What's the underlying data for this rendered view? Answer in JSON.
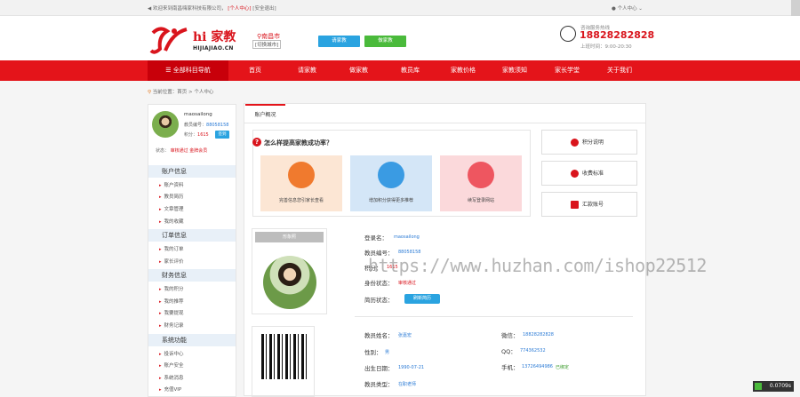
{
  "topbar": {
    "welcome": "欢迎来到南昌嗨家科技有限公司，",
    "personal": "[个人中心]",
    "logout": "[安全退出]",
    "user_menu": "个人中心 ⌄"
  },
  "header": {
    "logo_text": "hi 家教",
    "logo_sub": "HIJIAJIAO.CN",
    "city": "南昌市",
    "city_switch": "[切换城市]",
    "btn_request": "请家教",
    "btn_apply": "做家教",
    "hotline_label": "咨询服务热线",
    "hotline_number": "18828282828",
    "hours": "上班时间：9:00-20:30"
  },
  "nav": {
    "all_subjects": "全部科目导航",
    "items": [
      "首页",
      "请家教",
      "做家教",
      "教员库",
      "家教价格",
      "家教须知",
      "家长学堂",
      "关于我们"
    ]
  },
  "breadcrumb": "当前位置：首页 > 个人中心",
  "sidebar": {
    "username": "maosailong",
    "member_id_label": "教员编号：",
    "member_id": "88058158",
    "points_label": "积分：",
    "points": "1615",
    "sign_button": "签到",
    "status_label": "状态：",
    "status_review": "审核通过",
    "status_level": "金牌会员",
    "groups": [
      {
        "title": "账户信息",
        "links": [
          "账户资料",
          "教员简历",
          "文章管理",
          "我的收藏"
        ]
      },
      {
        "title": "订单信息",
        "links": [
          "我的订单",
          "家长评价"
        ]
      },
      {
        "title": "财务信息",
        "links": [
          "我的积分",
          "我的推荐",
          "我要提现",
          "财务记录"
        ]
      },
      {
        "title": "系统功能",
        "links": [
          "投诉中心",
          "账户安全",
          "系统消息",
          "充值VIP"
        ]
      }
    ]
  },
  "main": {
    "tab": "账户概况",
    "how_title": "怎么样提高家教成功率？",
    "features": [
      "完善信息您引家长查看",
      "增加积分获得更多推荐",
      "续写登录网站"
    ],
    "side_buttons": [
      "积分说明",
      "收费标准",
      "汇款账号"
    ],
    "photo_tag": "形象照",
    "account": {
      "login_label": "登录名：",
      "login_value": "maosailong",
      "id_label": "教员编号：",
      "id_value": "88058158",
      "points_label": "积分：",
      "points_value": "1615",
      "identity_label": "身份状态：",
      "identity_value": "审核通过",
      "resume_label": "简历状态：",
      "resume_button": "刷新简历"
    },
    "profile": {
      "name_label": "教员姓名：",
      "name_value": "张嘉宏",
      "gender_label": "性别：",
      "gender_value": "男",
      "birth_label": "出生日期：",
      "birth_value": "1990-07-21",
      "type_label": "教员类型：",
      "type_value": "在职老师",
      "wechat_label": "微信：",
      "wechat_value": "18828282828",
      "qq_label": "QQ：",
      "qq_value": "774362532",
      "mobile_label": "手机：",
      "mobile_value": "13726494986",
      "mobile_verified": "已绑定"
    }
  },
  "watermark": "https://www.huzhan.com/ishop22512",
  "perf": "0.0709s",
  "colors": {
    "brand_red": "#e4141a",
    "accent_blue": "#2aa3e0",
    "accent_green": "#4aba3b"
  }
}
